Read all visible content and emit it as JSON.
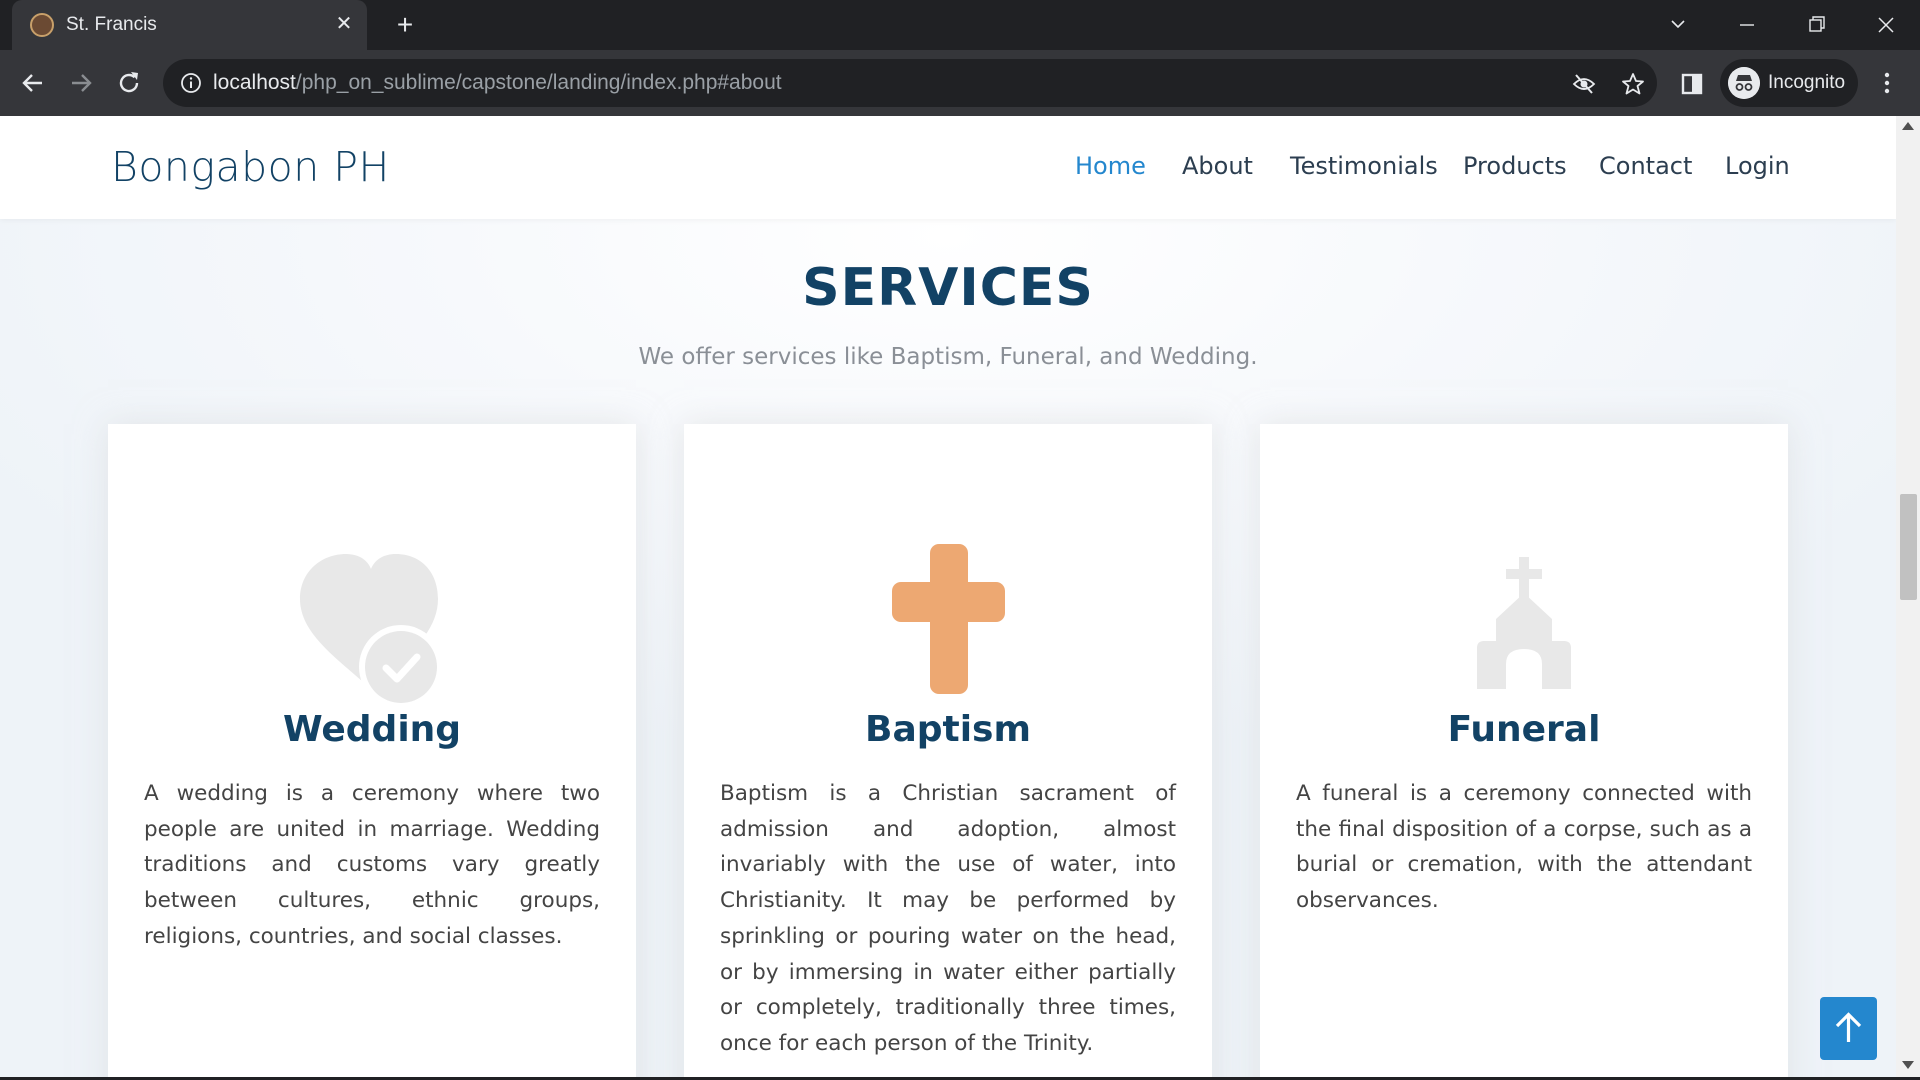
{
  "browser": {
    "tab_title": "St. Francis",
    "url_host": "localhost",
    "url_path": "/php_on_sublime/capstone/landing/index.php#about",
    "profile_label": "Incognito"
  },
  "site": {
    "brand": "Bongabon PH",
    "nav": [
      {
        "label": "Home",
        "active": true
      },
      {
        "label": "About"
      },
      {
        "label": "Testimonials"
      },
      {
        "label": "Products"
      },
      {
        "label": "Contact"
      },
      {
        "label": "Login"
      }
    ]
  },
  "services": {
    "title": "SERVICES",
    "subtitle": "We offer services like Baptism, Funeral, and Wedding.",
    "cards": [
      {
        "icon": "heart-check-icon",
        "title": "Wedding",
        "text": "A wedding is a ceremony where two people are united in marriage. Wedding traditions and customs vary greatly between cultures, ethnic groups, religions, countries, and social classes."
      },
      {
        "icon": "cross-icon",
        "title": "Baptism",
        "text": "Baptism is a Christian sacrament of admission and adoption, almost invariably with the use of water, into Christianity. It may be performed by sprinkling or pouring water on the head, or by immersing in water either partially or completely, traditionally three times, once for each person of the Trinity."
      },
      {
        "icon": "church-icon",
        "title": "Funeral",
        "text": "A funeral is a ceremony connected with the final disposition of a corpse, such as a burial or cremation, with the attendant observances."
      }
    ]
  },
  "colors": {
    "accent": "#2487ce",
    "heading": "#124265",
    "cross": "#eda872",
    "muted_icon": "#e8e8e8"
  }
}
